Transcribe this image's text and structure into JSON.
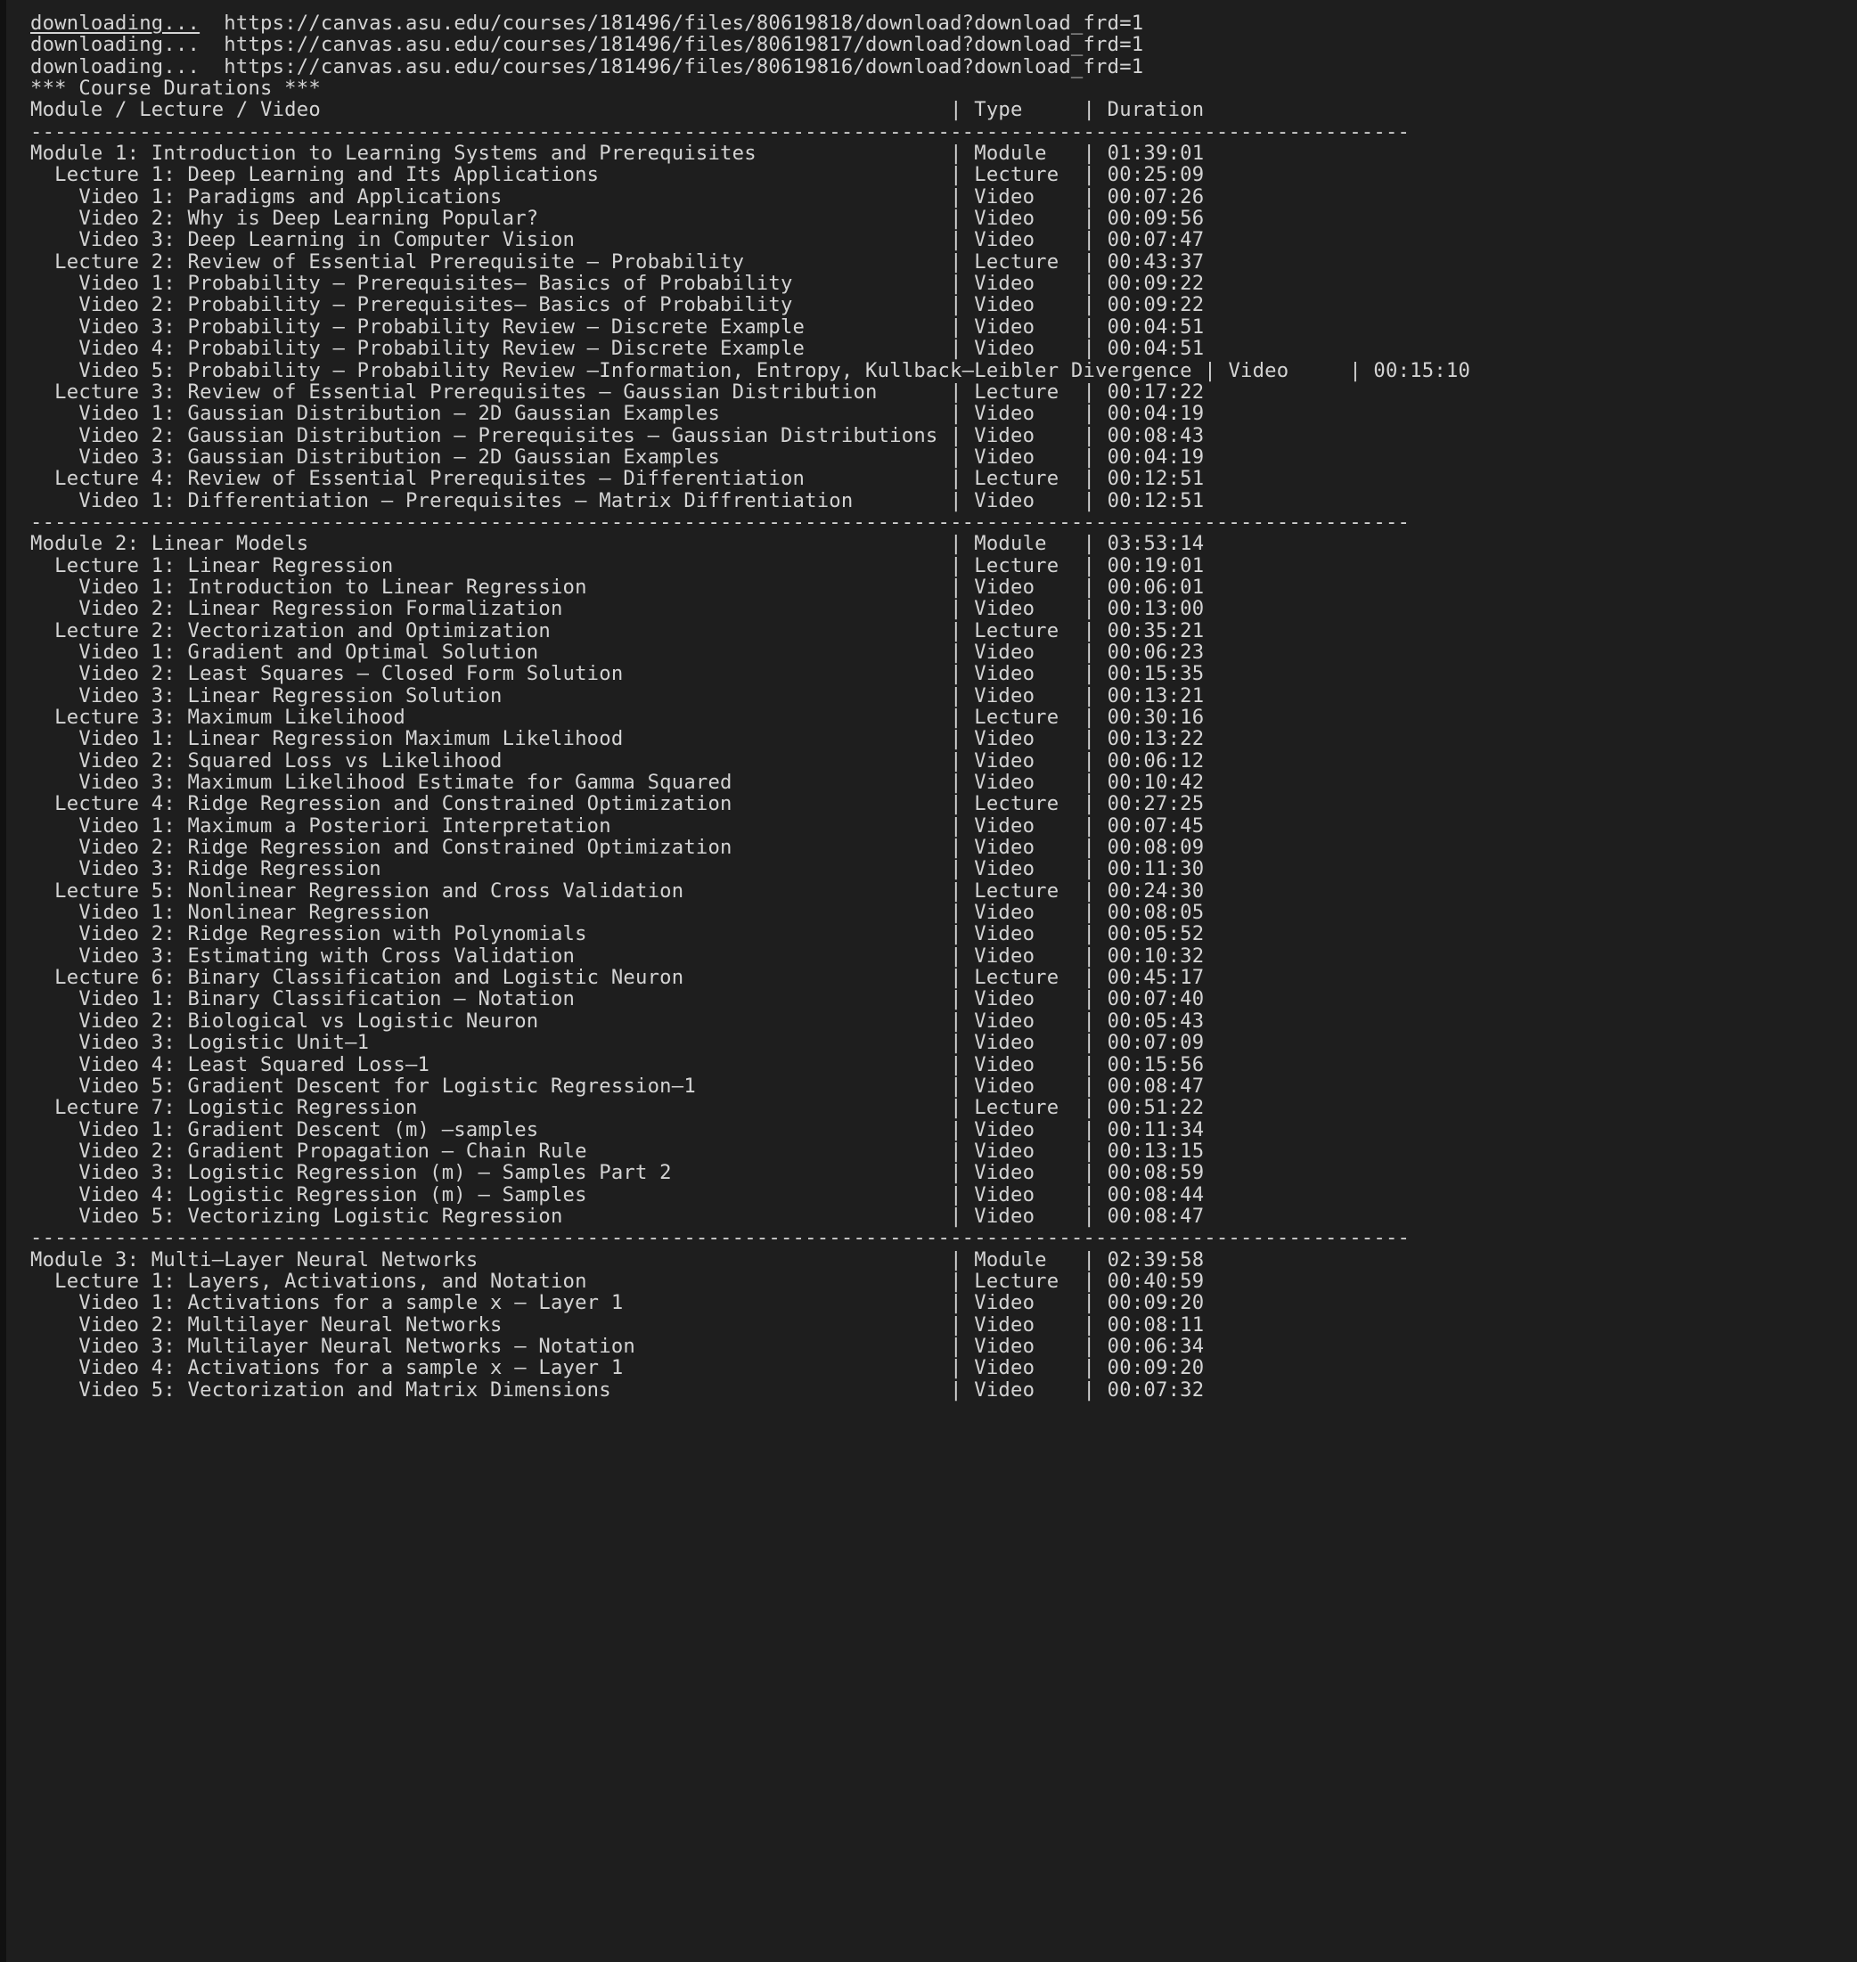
{
  "terminal": {
    "background": "#1e1e1e",
    "foreground": "#d4d4d4",
    "gutter": "#111111"
  },
  "downloads": [
    {
      "status": "downloading...",
      "url": "https://canvas.asu.edu/courses/181496/files/80619818/download?download_frd=1",
      "underlined": true
    },
    {
      "status": "downloading...",
      "url": "https://canvas.asu.edu/courses/181496/files/80619817/download?download_frd=1",
      "underlined": false
    },
    {
      "status": "downloading...",
      "url": "https://canvas.asu.edu/courses/181496/files/80619816/download?download_frd=1",
      "underlined": false
    }
  ],
  "report": {
    "title": "*** Course Durations ***",
    "header": {
      "name": "Module / Lecture / Video",
      "type": "Type",
      "duration": "Duration"
    },
    "separator": "------------------------------------------------------------------------------------------------------------------",
    "modules": [
      {
        "name": "Module 1: Introduction to Learning Systems and Prerequisites",
        "type": "Module",
        "duration": "01:39:01",
        "lectures": [
          {
            "name": "Lecture 1: Deep Learning and Its Applications",
            "type": "Lecture",
            "duration": "00:25:09",
            "videos": [
              {
                "name": "Video 1: Paradigms and Applications",
                "type": "Video",
                "duration": "00:07:26"
              },
              {
                "name": "Video 2: Why is Deep Learning Popular?",
                "type": "Video",
                "duration": "00:09:56"
              },
              {
                "name": "Video 3: Deep Learning in Computer Vision",
                "type": "Video",
                "duration": "00:07:47"
              }
            ]
          },
          {
            "name": "Lecture 2: Review of Essential Prerequisite – Probability",
            "type": "Lecture",
            "duration": "00:43:37",
            "videos": [
              {
                "name": "Video 1: Probability – Prerequisites– Basics of Probability",
                "type": "Video",
                "duration": "00:09:22"
              },
              {
                "name": "Video 2: Probability – Prerequisites– Basics of Probability",
                "type": "Video",
                "duration": "00:09:22"
              },
              {
                "name": "Video 3: Probability – Probability Review – Discrete Example",
                "type": "Video",
                "duration": "00:04:51"
              },
              {
                "name": "Video 4: Probability – Probability Review – Discrete Example",
                "type": "Video",
                "duration": "00:04:51"
              },
              {
                "name": "Video 5: Probability – Probability Review –Information, Entropy, Kullback–Leibler Divergence",
                "type": "Video",
                "duration": "00:15:10",
                "overflow": true
              }
            ]
          },
          {
            "name": "Lecture 3: Review of Essential Prerequisites – Gaussian Distribution",
            "type": "Lecture",
            "duration": "00:17:22",
            "videos": [
              {
                "name": "Video 1: Gaussian Distribution – 2D Gaussian Examples",
                "type": "Video",
                "duration": "00:04:19"
              },
              {
                "name": "Video 2: Gaussian Distribution – Prerequisites – Gaussian Distributions",
                "type": "Video",
                "duration": "00:08:43"
              },
              {
                "name": "Video 3: Gaussian Distribution – 2D Gaussian Examples",
                "type": "Video",
                "duration": "00:04:19"
              }
            ]
          },
          {
            "name": "Lecture 4: Review of Essential Prerequisites – Differentiation",
            "type": "Lecture",
            "duration": "00:12:51",
            "videos": [
              {
                "name": "Video 1: Differentiation – Prerequisites – Matrix Diffrentiation",
                "type": "Video",
                "duration": "00:12:51"
              }
            ]
          }
        ]
      },
      {
        "name": "Module 2: Linear Models",
        "type": "Module",
        "duration": "03:53:14",
        "lectures": [
          {
            "name": "Lecture 1: Linear Regression",
            "type": "Lecture",
            "duration": "00:19:01",
            "videos": [
              {
                "name": "Video 1: Introduction to Linear Regression",
                "type": "Video",
                "duration": "00:06:01"
              },
              {
                "name": "Video 2: Linear Regression Formalization",
                "type": "Video",
                "duration": "00:13:00"
              }
            ]
          },
          {
            "name": "Lecture 2: Vectorization and Optimization",
            "type": "Lecture",
            "duration": "00:35:21",
            "videos": [
              {
                "name": "Video 1: Gradient and Optimal Solution",
                "type": "Video",
                "duration": "00:06:23"
              },
              {
                "name": "Video 2: Least Squares – Closed Form Solution",
                "type": "Video",
                "duration": "00:15:35"
              },
              {
                "name": "Video 3: Linear Regression Solution",
                "type": "Video",
                "duration": "00:13:21"
              }
            ]
          },
          {
            "name": "Lecture 3: Maximum Likelihood",
            "type": "Lecture",
            "duration": "00:30:16",
            "videos": [
              {
                "name": "Video 1: Linear Regression Maximum Likelihood",
                "type": "Video",
                "duration": "00:13:22"
              },
              {
                "name": "Video 2: Squared Loss vs Likelihood",
                "type": "Video",
                "duration": "00:06:12"
              },
              {
                "name": "Video 3: Maximum Likelihood Estimate for Gamma Squared",
                "type": "Video",
                "duration": "00:10:42"
              }
            ]
          },
          {
            "name": "Lecture 4: Ridge Regression and Constrained Optimization",
            "type": "Lecture",
            "duration": "00:27:25",
            "videos": [
              {
                "name": "Video 1: Maximum a Posteriori Interpretation",
                "type": "Video",
                "duration": "00:07:45"
              },
              {
                "name": "Video 2: Ridge Regression and Constrained Optimization",
                "type": "Video",
                "duration": "00:08:09"
              },
              {
                "name": "Video 3: Ridge Regression",
                "type": "Video",
                "duration": "00:11:30"
              }
            ]
          },
          {
            "name": "Lecture 5: Nonlinear Regression and Cross Validation",
            "type": "Lecture",
            "duration": "00:24:30",
            "videos": [
              {
                "name": "Video 1: Nonlinear Regression",
                "type": "Video",
                "duration": "00:08:05"
              },
              {
                "name": "Video 2: Ridge Regression with Polynomials",
                "type": "Video",
                "duration": "00:05:52"
              },
              {
                "name": "Video 3: Estimating with Cross Validation",
                "type": "Video",
                "duration": "00:10:32"
              }
            ]
          },
          {
            "name": "Lecture 6: Binary Classification and Logistic Neuron",
            "type": "Lecture",
            "duration": "00:45:17",
            "videos": [
              {
                "name": "Video 1: Binary Classification – Notation",
                "type": "Video",
                "duration": "00:07:40"
              },
              {
                "name": "Video 2: Biological vs Logistic Neuron",
                "type": "Video",
                "duration": "00:05:43"
              },
              {
                "name": "Video 3: Logistic Unit–1",
                "type": "Video",
                "duration": "00:07:09"
              },
              {
                "name": "Video 4: Least Squared Loss–1",
                "type": "Video",
                "duration": "00:15:56"
              },
              {
                "name": "Video 5: Gradient Descent for Logistic Regression–1",
                "type": "Video",
                "duration": "00:08:47"
              }
            ]
          },
          {
            "name": "Lecture 7: Logistic Regression",
            "type": "Lecture",
            "duration": "00:51:22",
            "videos": [
              {
                "name": "Video 1: Gradient Descent (m) –samples",
                "type": "Video",
                "duration": "00:11:34"
              },
              {
                "name": "Video 2: Gradient Propagation – Chain Rule",
                "type": "Video",
                "duration": "00:13:15"
              },
              {
                "name": "Video 3: Logistic Regression (m) – Samples Part 2",
                "type": "Video",
                "duration": "00:08:59"
              },
              {
                "name": "Video 4: Logistic Regression (m) – Samples",
                "type": "Video",
                "duration": "00:08:44"
              },
              {
                "name": "Video 5: Vectorizing Logistic Regression",
                "type": "Video",
                "duration": "00:08:47"
              }
            ]
          }
        ]
      },
      {
        "name": "Module 3: Multi–Layer Neural Networks",
        "type": "Module",
        "duration": "02:39:58",
        "lectures": [
          {
            "name": "Lecture 1: Layers, Activations, and Notation",
            "type": "Lecture",
            "duration": "00:40:59",
            "videos": [
              {
                "name": "Video 1: Activations for a sample x – Layer 1",
                "type": "Video",
                "duration": "00:09:20"
              },
              {
                "name": "Video 2: Multilayer Neural Networks",
                "type": "Video",
                "duration": "00:08:11"
              },
              {
                "name": "Video 3: Multilayer Neural Networks – Notation",
                "type": "Video",
                "duration": "00:06:34"
              },
              {
                "name": "Video 4: Activations for a sample x – Layer 1",
                "type": "Video",
                "duration": "00:09:20"
              },
              {
                "name": "Video 5: Vectorization and Matrix Dimensions",
                "type": "Video",
                "duration": "00:07:32"
              }
            ]
          }
        ]
      }
    ]
  }
}
